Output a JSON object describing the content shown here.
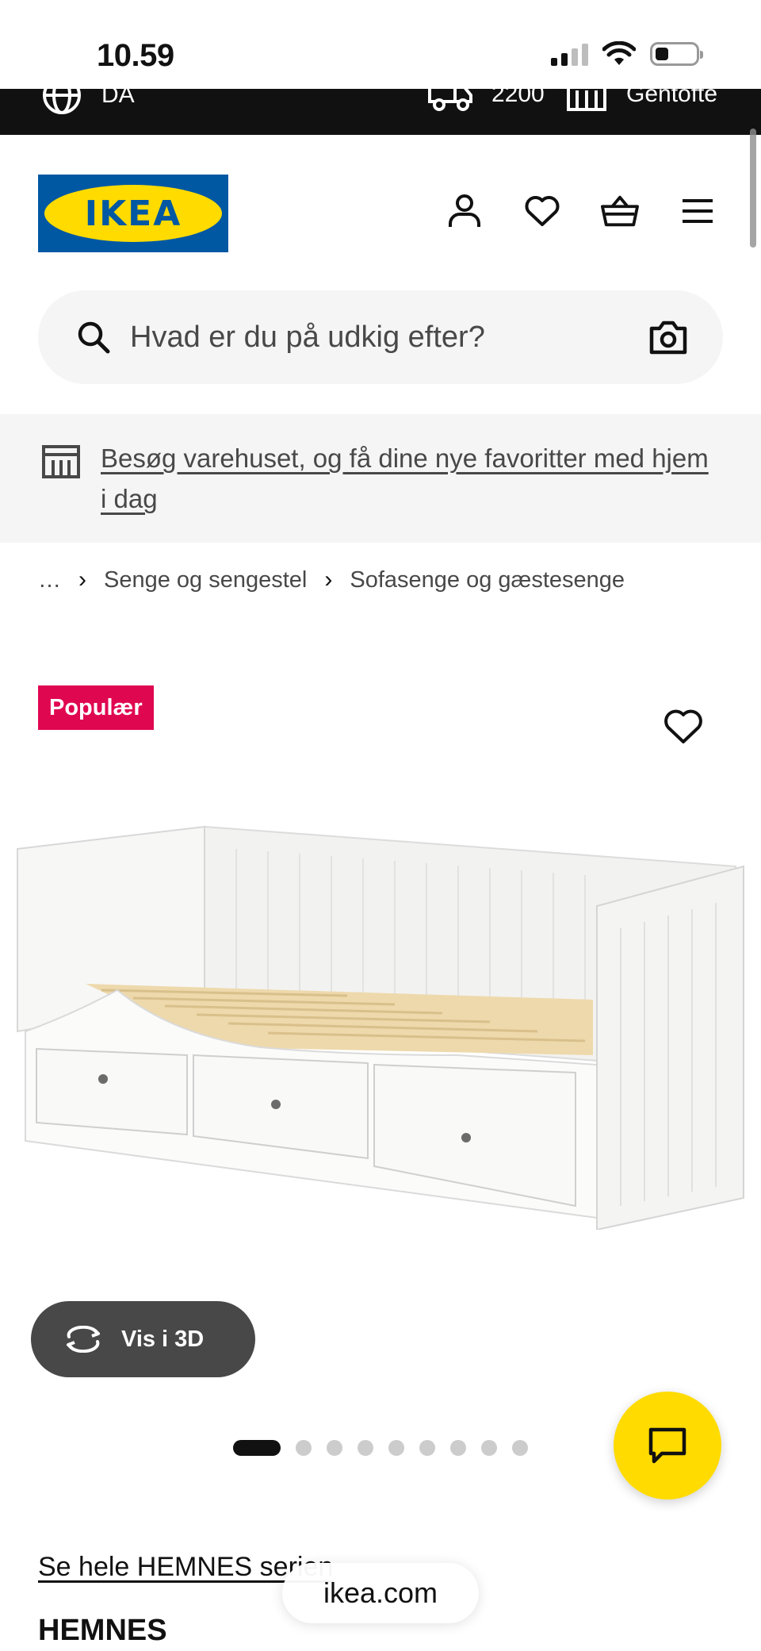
{
  "status_bar": {
    "time": "10.59"
  },
  "top_strip": {
    "language": "DA",
    "delivery_postcode": "2200",
    "store": "Gentofte"
  },
  "header": {
    "logo_text": "IKEA",
    "icons": [
      "profile-icon",
      "heart-icon",
      "basket-icon",
      "menu-icon"
    ]
  },
  "search": {
    "placeholder": "Hvad er du på udkig efter?"
  },
  "store_banner": {
    "text": "Besøg varehuset, og få dine nye favoritter med hjem i dag"
  },
  "breadcrumb": {
    "items": [
      "…",
      "Senge og sengestel",
      "Sofasenge og gæstesenge"
    ]
  },
  "product": {
    "badge": "Populær",
    "view_3d_label": "Vis i 3D",
    "series_link": "Se hele HEMNES serien",
    "name": "HEMNES",
    "gallery": {
      "count": 9,
      "active_index": 0
    }
  },
  "browser": {
    "url": "ikea.com"
  },
  "colors": {
    "ikea_blue": "#0058a3",
    "ikea_yellow": "#ffdb00",
    "badge_pink": "#e00751",
    "dark": "#111111",
    "grey_btn": "#484848"
  }
}
